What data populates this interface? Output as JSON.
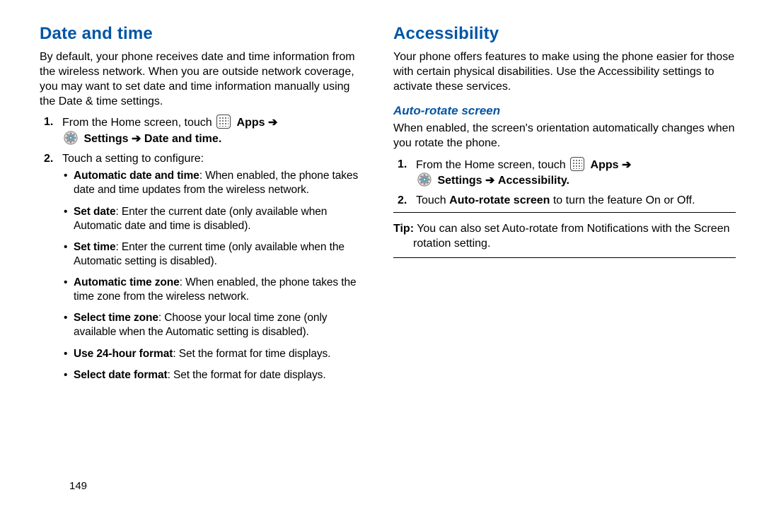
{
  "left": {
    "heading": "Date and time",
    "intro": "By default, your phone receives date and time information from the wireless network. When you are outside network coverage, you may want to set date and time information manually using the Date & time settings.",
    "step1_prefix": "From the Home screen, touch ",
    "apps_label": "Apps",
    "arrow": "➔",
    "settings_label": "Settings",
    "step1_suffix": "Date and time",
    "step2": "Touch a setting to configure:",
    "bullets": [
      {
        "term": "Automatic date and time",
        "desc": ": When enabled, the phone takes date and time updates from the wireless network."
      },
      {
        "term": "Set date",
        "desc": ": Enter the current date (only available when Automatic date and time is disabled)."
      },
      {
        "term": "Set time",
        "desc": ": Enter the current time (only available when the Automatic setting is disabled)."
      },
      {
        "term": "Automatic time zone",
        "desc": ": When enabled, the phone takes the time zone from the wireless network."
      },
      {
        "term": "Select time zone",
        "desc": ": Choose your local time zone (only available when the Automatic setting is disabled)."
      },
      {
        "term": "Use 24-hour format",
        "desc": ": Set the format for time displays."
      },
      {
        "term": "Select date format",
        "desc": ": Set the format for date displays."
      }
    ]
  },
  "right": {
    "heading": "Accessibility",
    "intro": "Your phone offers features to make using the phone easier for those with certain physical disabilities. Use the Accessibility settings to activate these services.",
    "subhead": "Auto-rotate screen",
    "sub_intro": "When enabled, the screen's orientation automatically changes when you rotate the phone.",
    "step1_prefix": "From the Home screen, touch ",
    "apps_label": "Apps",
    "arrow": "➔",
    "settings_label": "Settings",
    "step1_suffix": "Accessibility",
    "step2_pre": "Touch ",
    "step2_bold": "Auto-rotate screen",
    "step2_post": " to turn the feature On or Off.",
    "tip_label": "Tip:",
    "tip_text": " You can also set Auto-rotate from Notifications with the Screen rotation setting."
  },
  "page_number": "149"
}
